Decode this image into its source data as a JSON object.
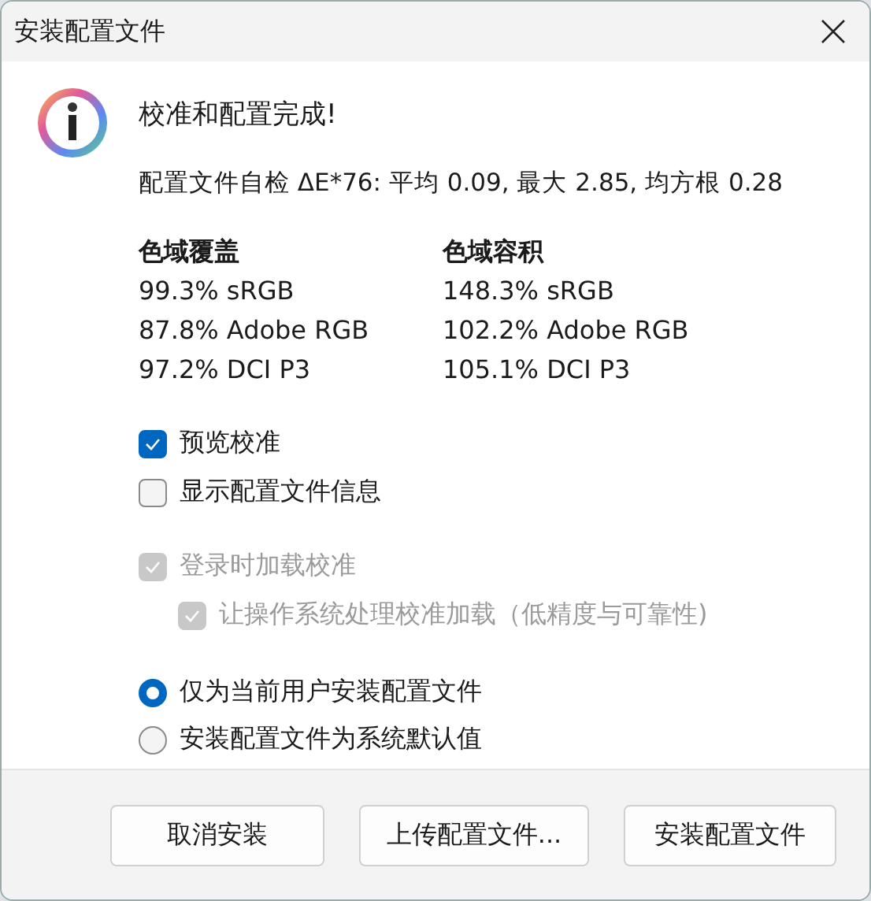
{
  "window": {
    "title": "安装配置文件"
  },
  "message": {
    "heading": "校准和配置完成!",
    "self_check": "配置文件自检 ΔE*76: 平均 0.09, 最大 2.85, 均方根 0.28"
  },
  "gamut": [
    {
      "heading": "色域覆盖",
      "values": [
        "99.3% sRGB",
        "87.8% Adobe RGB",
        "97.2% DCI P3"
      ]
    },
    {
      "heading": "色域容积",
      "values": [
        "148.3% sRGB",
        "102.2% Adobe RGB",
        "105.1% DCI P3"
      ]
    }
  ],
  "options": [
    {
      "label": "预览校准",
      "checked": true,
      "disabled": false
    },
    {
      "label": "显示配置文件信息",
      "checked": false,
      "disabled": false
    }
  ],
  "login_options": [
    {
      "label": "登录时加载校准",
      "checked": true,
      "disabled": true,
      "children": [
        {
          "label": "让操作系统处理校准加载（低精度与可靠性)",
          "checked": true,
          "disabled": true
        }
      ]
    }
  ],
  "install_scope": [
    {
      "label": "仅为当前用户安装配置文件",
      "selected": true
    },
    {
      "label": "安装配置文件为系统默认值",
      "selected": false
    }
  ],
  "buttons": [
    "取消安装",
    "上传配置文件...",
    "安装配置文件"
  ]
}
